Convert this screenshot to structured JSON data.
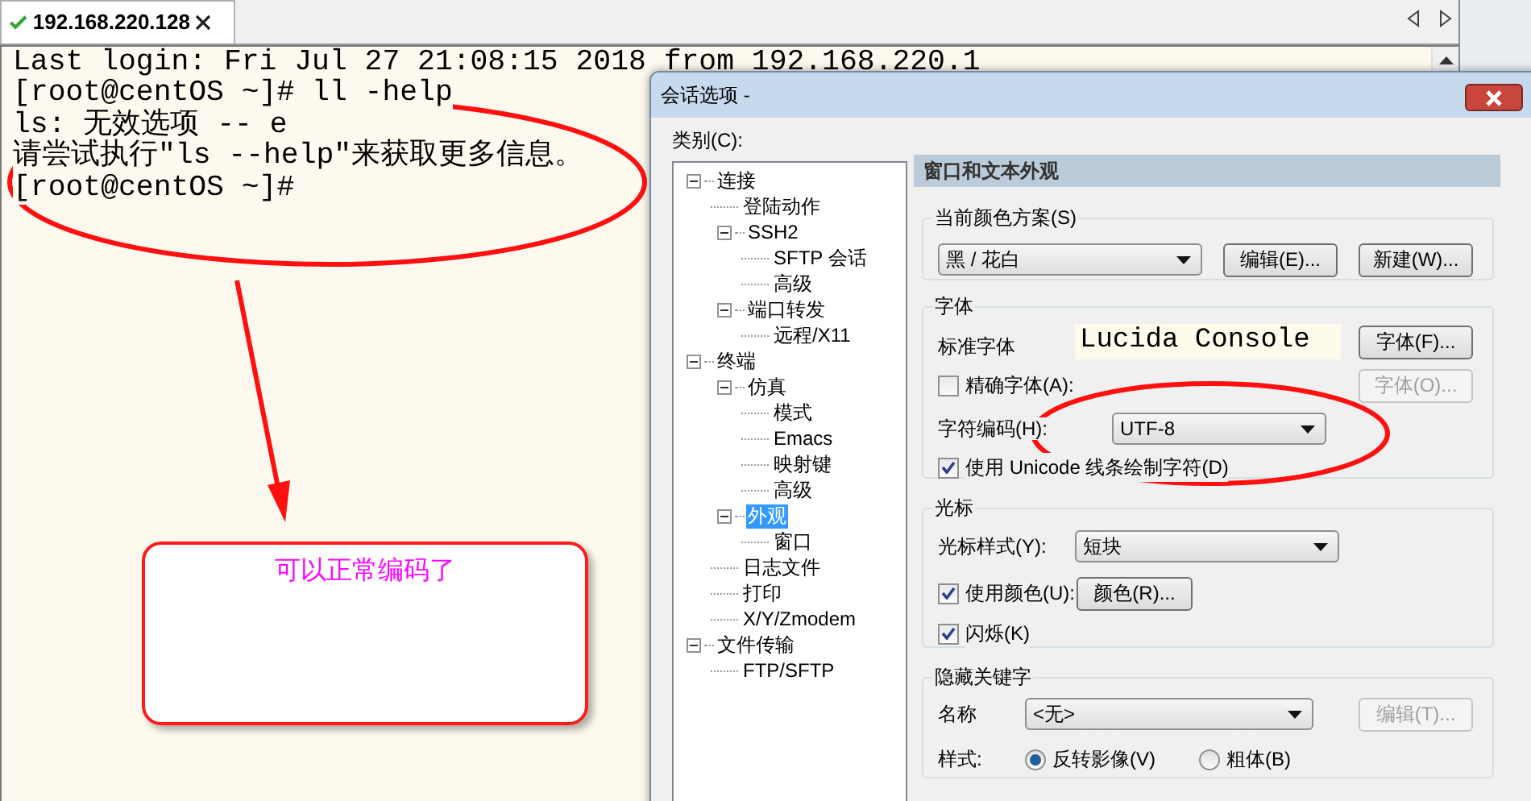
{
  "tab": {
    "title": "192.168.220.128",
    "selected": true
  },
  "terminal": {
    "lines": [
      "Last login: Fri Jul 27 21:08:15 2018 from 192.168.220.1",
      "[root@centOS ~]# ll -help",
      "ls: 无效选项 -- e",
      "请尝试执行\"ls --help\"来获取更多信息。",
      "[root@centOS ~]#"
    ]
  },
  "annotation": {
    "note": "可以正常编码了"
  },
  "dialog": {
    "title": "会话选项 -",
    "category_label": "类别(C):",
    "tree": [
      {
        "label": "连接",
        "expanded": true,
        "selected": false,
        "children": [
          {
            "label": "登陆动作",
            "selected": false
          },
          {
            "label": "SSH2",
            "expanded": true,
            "selected": false,
            "children": [
              {
                "label": "SFTP 会话",
                "selected": false
              },
              {
                "label": "高级",
                "selected": false
              }
            ]
          },
          {
            "label": "端口转发",
            "expanded": true,
            "selected": false,
            "children": [
              {
                "label": "远程/X11",
                "selected": false
              }
            ]
          }
        ]
      },
      {
        "label": "终端",
        "expanded": true,
        "selected": false,
        "children": [
          {
            "label": "仿真",
            "expanded": true,
            "selected": false,
            "children": [
              {
                "label": "模式",
                "selected": false
              },
              {
                "label": "Emacs",
                "selected": false
              },
              {
                "label": "映射键",
                "selected": false
              },
              {
                "label": "高级",
                "selected": false
              }
            ]
          },
          {
            "label": "外观",
            "expanded": true,
            "selected": true,
            "children": [
              {
                "label": "窗口",
                "selected": false
              }
            ]
          },
          {
            "label": "日志文件",
            "selected": false
          },
          {
            "label": "打印",
            "selected": false
          },
          {
            "label": "X/Y/Zmodem",
            "selected": false
          }
        ]
      },
      {
        "label": "文件传输",
        "expanded": true,
        "selected": false,
        "children": [
          {
            "label": "FTP/SFTP",
            "selected": false
          }
        ]
      }
    ],
    "panel": {
      "header": "窗口和文本外观",
      "color_scheme": {
        "title": "当前颜色方案(S)",
        "scheme": "黑 / 花白",
        "buttons": [
          {
            "label": "编辑(E)...",
            "disabled": false
          },
          {
            "label": "新建(W)...",
            "disabled": false
          }
        ]
      },
      "font": {
        "title": "字体",
        "standard_label": "标准字体",
        "font_name": "Lucida Console",
        "font_button": {
          "label": "字体(F)...",
          "disabled": false
        },
        "precise": {
          "label": "精确字体(A):",
          "checked": false
        },
        "precise_button": {
          "label": "字体(O)...",
          "disabled": true
        },
        "encoding_label": "字符编码(H):",
        "encoding": "UTF-8",
        "unicode": {
          "label": "使用 Unicode 线条绘制字符(D)",
          "checked": true
        }
      },
      "cursor": {
        "title": "光标",
        "style_label": "光标样式(Y):",
        "style": "短块",
        "use_color": {
          "label": "使用颜色(U):",
          "checked": true
        },
        "color_button": {
          "label": "颜色(R)...",
          "disabled": false
        },
        "blink": {
          "label": "闪烁(K)",
          "checked": true
        }
      },
      "keywords": {
        "title": "隐藏关键字",
        "name_label": "名称",
        "name": "<无>",
        "edit_button": {
          "label": "编辑(T)...",
          "disabled": true
        },
        "style_label": "样式:",
        "styles": [
          {
            "label": "反转影像(V)",
            "selected": true
          },
          {
            "label": "粗体(B)",
            "selected": false
          }
        ]
      }
    }
  }
}
